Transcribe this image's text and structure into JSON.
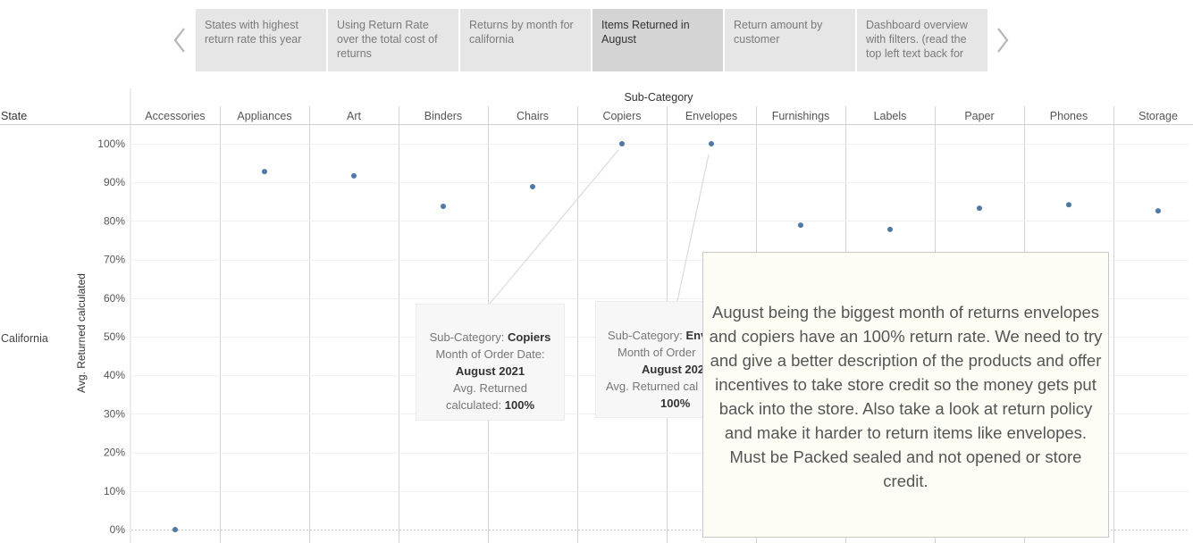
{
  "story": {
    "points": [
      {
        "label": "States with highest return rate this year",
        "active": false
      },
      {
        "label": "Using Return Rate over the total cost of returns",
        "active": false
      },
      {
        "label": "Returns by month for california",
        "active": false
      },
      {
        "label": "Items Returned in August",
        "active": true
      },
      {
        "label": "Return amount  by customer",
        "active": false
      },
      {
        "label": "Dashboard overview with  filters. (read the top left text back for",
        "active": false
      }
    ]
  },
  "chart": {
    "column_header": "Sub-Category",
    "row_header": "State",
    "row_value": "California",
    "y_axis_title": "Avg. Returned calculated",
    "y_ticks": [
      "0%",
      "10%",
      "20%",
      "30%",
      "40%",
      "50%",
      "60%",
      "70%",
      "80%",
      "90%",
      "100%"
    ]
  },
  "chart_data": {
    "type": "scatter",
    "xlabel": "Sub-Category",
    "ylabel": "Avg. Returned calculated",
    "ylim": [
      0,
      100
    ],
    "categories": [
      "Accessories",
      "Appliances",
      "Art",
      "Binders",
      "Chairs",
      "Copiers",
      "Envelopes",
      "Furnishings",
      "Labels",
      "Paper",
      "Phones",
      "Storage"
    ],
    "series": [
      {
        "values": [
          0,
          92.8,
          91.7,
          83.8,
          88.9,
          100,
          100,
          78.9,
          77.8,
          83.3,
          84.2,
          82.6
        ]
      }
    ],
    "color": "#4e79a7",
    "grid": true
  },
  "tooltips": [
    {
      "category_label": "Sub-Category:",
      "category_value": "Copiers",
      "month_label": "Month of Order Date:",
      "month_value": "August 2021",
      "measure_label_1": "Avg. Returned",
      "measure_label_2": "calculated:",
      "measure_value": "100%"
    },
    {
      "category_label": "Sub-Category:",
      "category_value": "Env",
      "month_label": "Month of Order",
      "month_value": "August 202",
      "measure_label_1": "Avg. Returned cal",
      "measure_value": "100%"
    }
  ],
  "annotation": {
    "text": "August being the biggest month of returns envelopes and copiers have an 100% return rate. We need to try and give a better description of the products and offer incentives to take store credit so the money gets put back into the store. Also take a look at return policy and make it harder to return items like envelopes. Must be Packed sealed and not opened or store credit."
  }
}
